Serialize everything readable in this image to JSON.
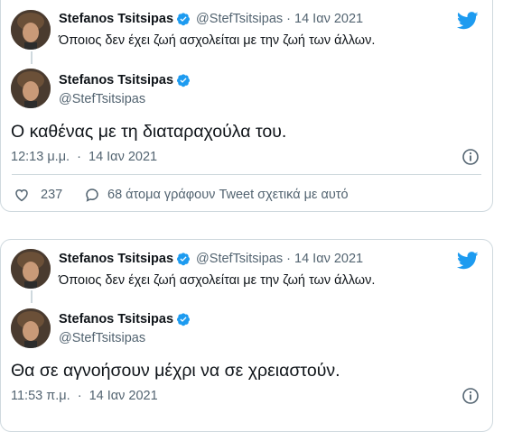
{
  "tweet1": {
    "quoted": {
      "name": "Stefanos Tsitsipas",
      "handle": "@StefTsitsipas",
      "separator": "·",
      "date": "14 Ιαν 2021",
      "text": "Όποιος δεν έχει ζωή ασχολείται με την ζωή των άλλων."
    },
    "author": {
      "name": "Stefanos Tsitsipas",
      "handle": "@StefTsitsipas"
    },
    "text": "Ο καθένας με τη διαταραχούλα του.",
    "time": "12:13 μ.μ.",
    "separator": "·",
    "date": "14 Ιαν 2021",
    "likes": "237",
    "replies_label": "68 άτομα γράφουν Tweet σχετικά με αυτό"
  },
  "tweet2": {
    "quoted": {
      "name": "Stefanos Tsitsipas",
      "handle": "@StefTsitsipas",
      "separator": "·",
      "date": "14 Ιαν 2021",
      "text": "Όποιος δεν έχει ζωή ασχολείται με την ζωή των άλλων."
    },
    "author": {
      "name": "Stefanos Tsitsipas",
      "handle": "@StefTsitsipas"
    },
    "text": "Θα σε αγνοήσουν μέχρι να σε χρειαστούν.",
    "time": "11:53 π.μ.",
    "separator": "·",
    "date": "14 Ιαν 2021"
  },
  "colors": {
    "brand": "#1d9bf0",
    "muted": "#536471",
    "border": "#cfd9de",
    "like": "#536471"
  },
  "icons": [
    "twitter-bird-icon",
    "verified-badge-icon",
    "info-icon",
    "heart-icon",
    "reply-icon"
  ]
}
